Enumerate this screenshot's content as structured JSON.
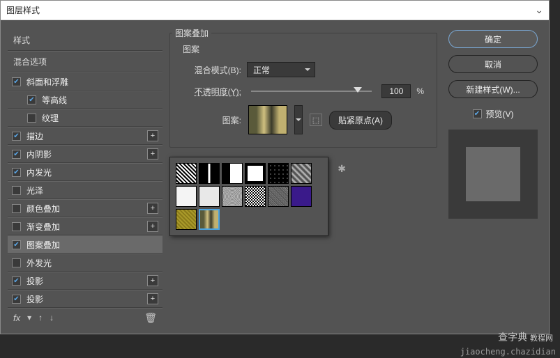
{
  "window": {
    "title": "图层样式"
  },
  "sidebar": {
    "header": "样式",
    "blend_header": "混合选项",
    "items": [
      {
        "label": "斜面和浮雕",
        "checked": true,
        "plus": false,
        "indent": false
      },
      {
        "label": "等高线",
        "checked": true,
        "plus": false,
        "indent": true
      },
      {
        "label": "纹理",
        "checked": false,
        "plus": false,
        "indent": true
      },
      {
        "label": "描边",
        "checked": true,
        "plus": true,
        "indent": false
      },
      {
        "label": "内阴影",
        "checked": true,
        "plus": true,
        "indent": false
      },
      {
        "label": "内发光",
        "checked": true,
        "plus": false,
        "indent": false
      },
      {
        "label": "光泽",
        "checked": false,
        "plus": false,
        "indent": false
      },
      {
        "label": "颜色叠加",
        "checked": false,
        "plus": true,
        "indent": false
      },
      {
        "label": "渐变叠加",
        "checked": false,
        "plus": true,
        "indent": false
      },
      {
        "label": "图案叠加",
        "checked": true,
        "plus": false,
        "indent": false,
        "selected": true
      },
      {
        "label": "外发光",
        "checked": false,
        "plus": false,
        "indent": false
      },
      {
        "label": "投影",
        "checked": true,
        "plus": true,
        "indent": false
      },
      {
        "label": "投影",
        "checked": true,
        "plus": true,
        "indent": false
      }
    ],
    "footer_fx": "fx"
  },
  "panel": {
    "title": "图案叠加",
    "subtitle": "图案",
    "blend_label": "混合模式(B):",
    "blend_value": "正常",
    "opacity_label": "不透明度(Y):",
    "opacity_value": "100",
    "opacity_unit": "%",
    "pattern_label": "图案:",
    "snap_label": "贴紧原点(A)"
  },
  "right": {
    "ok": "确定",
    "cancel": "取消",
    "new_style": "新建样式(W)...",
    "preview": "预览(V)"
  },
  "watermark_main": "查字典",
  "watermark_side": "教程网",
  "watermark_url": "jiaocheng.chazidian"
}
